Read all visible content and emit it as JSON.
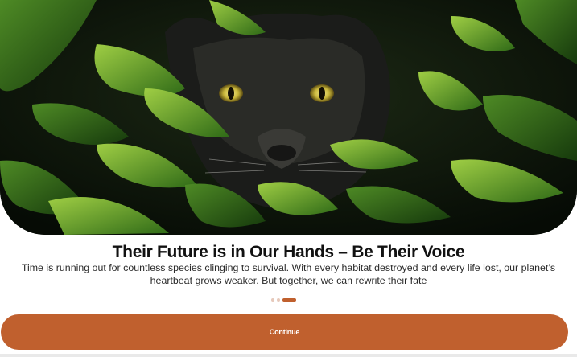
{
  "hero": {
    "image_subject": "black panther in jungle foliage",
    "icon": "panther-photo"
  },
  "headline": "Their Future is in Our Hands – Be Their Voice",
  "body": "Time is running out for countless species clinging to survival. With every habitat destroyed and every life lost, our planet’s heartbeat grows weaker. But together, we can rewrite their fate",
  "pagination": {
    "total": 3,
    "current": 3
  },
  "continue_button": {
    "label": "Continue"
  },
  "colors": {
    "accent": "#c0602e",
    "accent_light": "#e6c9bb",
    "text": "#111111",
    "background": "#ffffff"
  }
}
